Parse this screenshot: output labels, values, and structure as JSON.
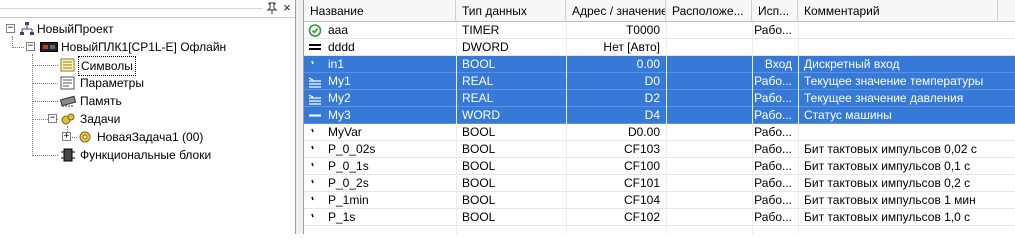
{
  "tree": {
    "toolbar": {
      "pin_icon": "pin-icon",
      "close_label": "×"
    },
    "project": "НовыйПроект",
    "plc": "НовыйПЛК1[CP1L-E] Офлайн",
    "items": {
      "symbols": "Символы",
      "params": "Параметры",
      "memory": "Память",
      "tasks": "Задачи",
      "task1": "НоваяЗадача1 (00)",
      "fb": "Функциональные блоки"
    },
    "expand_minus": "−",
    "expand_plus": "+"
  },
  "table": {
    "columns": {
      "name": "Название",
      "type": "Тип данных",
      "addr": "Адрес / значение",
      "loc": "Расположе...",
      "use": "Исп...",
      "comment": "Комментарий"
    },
    "rows": [
      {
        "icon": "timer-icon",
        "name": "aaa",
        "type": "TIMER",
        "addr": "T0000",
        "loc": "",
        "use": "Рабо...",
        "comment": "",
        "selected": false
      },
      {
        "icon": "dword-icon",
        "name": "dddd",
        "type": "DWORD",
        "addr": "Нет [Авто]",
        "loc": "",
        "use": "",
        "comment": "",
        "selected": false
      },
      {
        "icon": "bool-icon",
        "name": "in1",
        "type": "BOOL",
        "addr": "0.00",
        "loc": "",
        "use": "Вход",
        "comment": "Дискретный вход",
        "selected": true
      },
      {
        "icon": "real-icon",
        "name": "My1",
        "type": "REAL",
        "addr": "D0",
        "loc": "",
        "use": "Рабо...",
        "comment": "Текущее значение температуры",
        "selected": true
      },
      {
        "icon": "real-icon",
        "name": "My2",
        "type": "REAL",
        "addr": "D2",
        "loc": "",
        "use": "Рабо...",
        "comment": "Текущее значение давления",
        "selected": true
      },
      {
        "icon": "word-icon",
        "name": "My3",
        "type": "WORD",
        "addr": "D4",
        "loc": "",
        "use": "Рабо...",
        "comment": "Статус машины",
        "selected": true
      },
      {
        "icon": "bool-icon",
        "name": "MyVar",
        "type": "BOOL",
        "addr": "D0.00",
        "loc": "",
        "use": "Рабо...",
        "comment": "",
        "selected": false
      },
      {
        "icon": "bool-icon",
        "name": "P_0_02s",
        "type": "BOOL",
        "addr": "CF103",
        "loc": "",
        "use": "Рабо...",
        "comment": "Бит тактовых импульсов 0,02 с",
        "selected": false
      },
      {
        "icon": "bool-icon",
        "name": "P_0_1s",
        "type": "BOOL",
        "addr": "CF100",
        "loc": "",
        "use": "Рабо...",
        "comment": "Бит тактовых импульсов 0,1 с",
        "selected": false
      },
      {
        "icon": "bool-icon",
        "name": "P_0_2s",
        "type": "BOOL",
        "addr": "CF101",
        "loc": "",
        "use": "Рабо...",
        "comment": "Бит тактовых импульсов 0,2 с",
        "selected": false
      },
      {
        "icon": "bool-icon",
        "name": "P_1min",
        "type": "BOOL",
        "addr": "CF104",
        "loc": "",
        "use": "Рабо...",
        "comment": "Бит тактовых импульсов 1 мин",
        "selected": false
      },
      {
        "icon": "bool-icon",
        "name": "P_1s",
        "type": "BOOL",
        "addr": "CF102",
        "loc": "",
        "use": "Рабо...",
        "comment": "Бит тактовых импульсов 1,0 с",
        "selected": false
      }
    ]
  },
  "colors": {
    "selection": "#3679d6",
    "header_bg": "#f7f7f7",
    "timer_green": "#2e9a2e"
  }
}
